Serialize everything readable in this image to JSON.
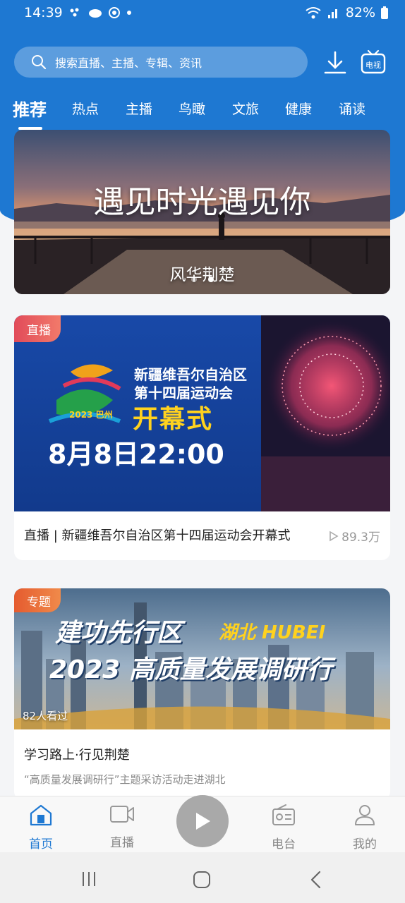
{
  "status": {
    "time": "14:39",
    "battery": "82%"
  },
  "search": {
    "placeholder": "搜索直播、主播、专辑、资讯"
  },
  "header": {
    "tv_label": "电视"
  },
  "tabs": [
    "推荐",
    "热点",
    "主播",
    "鸟瞰",
    "文旅",
    "健康",
    "诵读"
  ],
  "banner": {
    "title": "遇见时光遇见你",
    "subtitle": "风华荆楚"
  },
  "live_card": {
    "badge": "直播",
    "image_lines": [
      "新疆维吾尔自治区",
      "第十四届运动会",
      "开幕式",
      "8月8日22:00",
      "2023 巴州"
    ],
    "title": "直播 | 新疆维吾尔自治区第十四届运动会开幕式",
    "views": "89.3万"
  },
  "topic_card": {
    "badge": "专题",
    "image_lines": [
      "建功先行区",
      "湖北 HUBEI",
      "2023 高质量发展调研行"
    ],
    "watched": "82人看过",
    "title": "学习路上·行见荆楚",
    "subtitle": "“高质量发展调研行”主题采访活动走进湖北"
  },
  "bottom_nav": [
    {
      "label": "首页",
      "icon": "home-icon"
    },
    {
      "label": "直播",
      "icon": "video-camera-icon"
    },
    {
      "label": "电台",
      "icon": "radio-icon"
    },
    {
      "label": "我的",
      "icon": "user-icon"
    }
  ],
  "colors": {
    "primary": "#1e78d2",
    "live_badge": "#e14b5a",
    "topic_badge": "#e55b2f"
  }
}
